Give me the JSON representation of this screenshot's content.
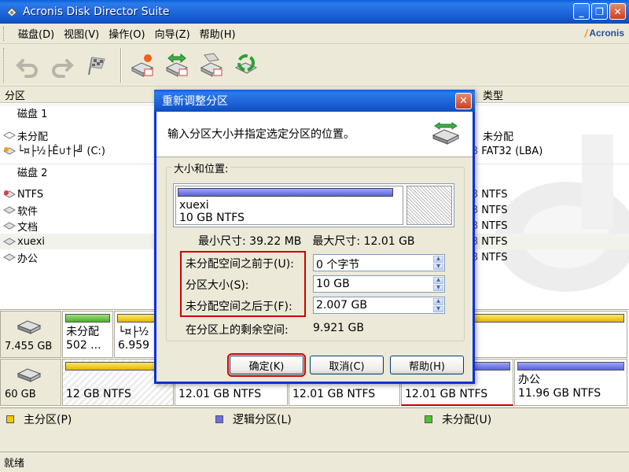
{
  "window": {
    "title": "Acronis Disk Director Suite",
    "brand": "Acronis",
    "controls": [
      "_",
      "❐",
      "✕"
    ]
  },
  "menu": [
    {
      "label": "磁盘(D)"
    },
    {
      "label": "视图(V)"
    },
    {
      "label": "操作(O)"
    },
    {
      "label": "向导(Z)"
    },
    {
      "label": "帮助(H)"
    }
  ],
  "toolbar": [
    {
      "icon": "undo-icon"
    },
    {
      "icon": "redo-icon"
    },
    {
      "icon": "commit-flag-icon"
    },
    {
      "icon": "new-partition-icon"
    },
    {
      "icon": "copy-partition-icon"
    },
    {
      "icon": "recovery-icon"
    },
    {
      "icon": "recycle-icon"
    }
  ],
  "list": {
    "col_partition": "分区",
    "col_type": "类型",
    "rows": [
      {
        "text": "磁盘 1",
        "kind": "disk"
      },
      {
        "text": "未分配",
        "kind": "part",
        "type": "未分配",
        "prefix": ""
      },
      {
        "text": "└¤├½├Ê∪†├╝ (C:)",
        "kind": "part",
        "type": "FAT32 (LBA)",
        "prefix": "3"
      },
      {
        "text": "磁盘 2",
        "kind": "disk"
      },
      {
        "text": "NTFS",
        "kind": "part",
        "type": "NTFS",
        "prefix": "3"
      },
      {
        "text": "软件",
        "kind": "part",
        "type": "NTFS",
        "prefix": "3"
      },
      {
        "text": "文档",
        "kind": "part",
        "type": "NTFS",
        "prefix": "3"
      },
      {
        "text": "xuexi",
        "kind": "part",
        "type": "NTFS",
        "prefix": "3"
      },
      {
        "text": "办公",
        "kind": "part",
        "type": "NTFS",
        "prefix": "3"
      }
    ]
  },
  "diskmap": {
    "disk1": {
      "size": "7.455 GB",
      "seg1": {
        "line1": "未分配",
        "line2": "502 ..."
      },
      "seg2": {
        "line1": "└¤├½",
        "line2": "6.959"
      }
    },
    "disk2": {
      "size": "60 GB",
      "segs": [
        "12 GB  NTFS",
        "12.01 GB  NTFS",
        "12.01 GB  NTFS",
        "12.01 GB  NTFS"
      ],
      "last": {
        "line1": "办公",
        "line2": "11.96 GB  NTFS"
      }
    }
  },
  "legend": {
    "primary": "主分区(P)",
    "logical": "逻辑分区(L)",
    "unalloc": "未分配(U)",
    "colors": {
      "primary": "#F0C800",
      "logical": "#6A70E0",
      "unalloc": "#4FC030"
    }
  },
  "status": "就绪",
  "dialog": {
    "title": "重新调整分区",
    "instruction": "输入分区大小并指定选定分区的位置。",
    "group_label": "大小和位置:",
    "partition_name": "xuexi",
    "partition_info": "10 GB  NTFS",
    "min_size": "最小尺寸: 39.22 MB",
    "max_size": "最大尺寸: 12.01 GB",
    "fields": [
      {
        "label": "未分配空间之前于(U):",
        "value": "0 个字节"
      },
      {
        "label": "分区大小(S):",
        "value": "10 GB"
      },
      {
        "label": "未分配空间之后于(F):",
        "value": "2.007 GB"
      }
    ],
    "remaining_label": "在分区上的剩余空间:",
    "remaining_value": "9.921 GB",
    "ok": "确定(K)",
    "cancel": "取消(C)",
    "help": "帮助(H)"
  }
}
